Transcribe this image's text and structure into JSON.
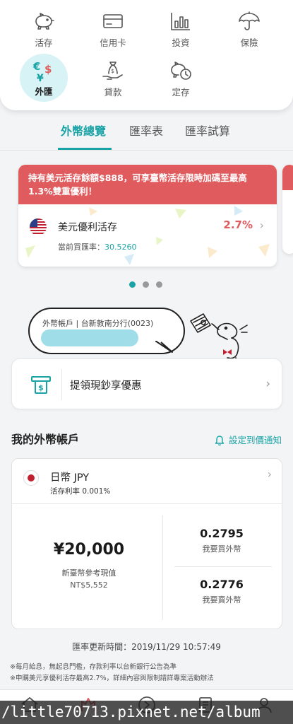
{
  "menu": {
    "items": [
      {
        "label": "活存",
        "icon": "piggy-bank-icon"
      },
      {
        "label": "信用卡",
        "icon": "credit-card-icon"
      },
      {
        "label": "投資",
        "icon": "bar-chart-icon"
      },
      {
        "label": "保險",
        "icon": "umbrella-icon"
      },
      {
        "label": "外匯",
        "icon": "currency-exchange-icon",
        "active": true
      },
      {
        "label": "貸款",
        "icon": "money-hand-icon"
      },
      {
        "label": "定存",
        "icon": "piggy-clock-icon"
      }
    ]
  },
  "tabs": [
    {
      "label": "外幣總覽",
      "active": true
    },
    {
      "label": "匯率表"
    },
    {
      "label": "匯率試算"
    }
  ],
  "promo": {
    "banner": "持有美元活存餘額$888，可享臺幣活存限時加碼至最高1.3%雙重優利！",
    "product": "美元優利活存",
    "rate": "2.7%",
    "sub_label": "當前買匯率：",
    "sub_value": "30.5260"
  },
  "carousel": {
    "count": 3,
    "active_index": 0
  },
  "bubble": {
    "text": "外幣帳戶 | 台新敦南分行(0023)"
  },
  "atm": {
    "label": "提領現鈔享優惠",
    "icon": "atm-cash-icon"
  },
  "accounts": {
    "title": "我的外幣帳戶",
    "alert_label": "設定到價通知",
    "alert_icon": "bell-icon"
  },
  "account_card": {
    "currency": "日幣 JPY",
    "rate_text": "活存利率 0.001%",
    "balance": "¥20,000",
    "ref_label": "新臺幣參考現值",
    "ref_value": "NT$5,552",
    "buy_rate": "0.2795",
    "buy_label": "我要買外幣",
    "sell_rate": "0.2776",
    "sell_label": "我要賣外幣"
  },
  "footer": {
    "update_time": "匯率更新時間：2019/11/29 10:57:49",
    "disclaimer_1": "※每月給息，無起息門檻，存款利率以台新銀行公告為準",
    "disclaimer_2": "※申購美元享優利活存最高2.7%，詳細內容與限制請詳專案活動辦法"
  },
  "bottom_nav": {
    "icons": [
      "home-icon",
      "wealth-icon",
      "transfer-icon",
      "document-icon",
      "profile-icon"
    ]
  },
  "watermark": "/little70713.pixnet.net/album",
  "colors": {
    "accent": "#1aa3a6",
    "promo_red": "#e05b5e",
    "background": "#f3f4f6"
  }
}
